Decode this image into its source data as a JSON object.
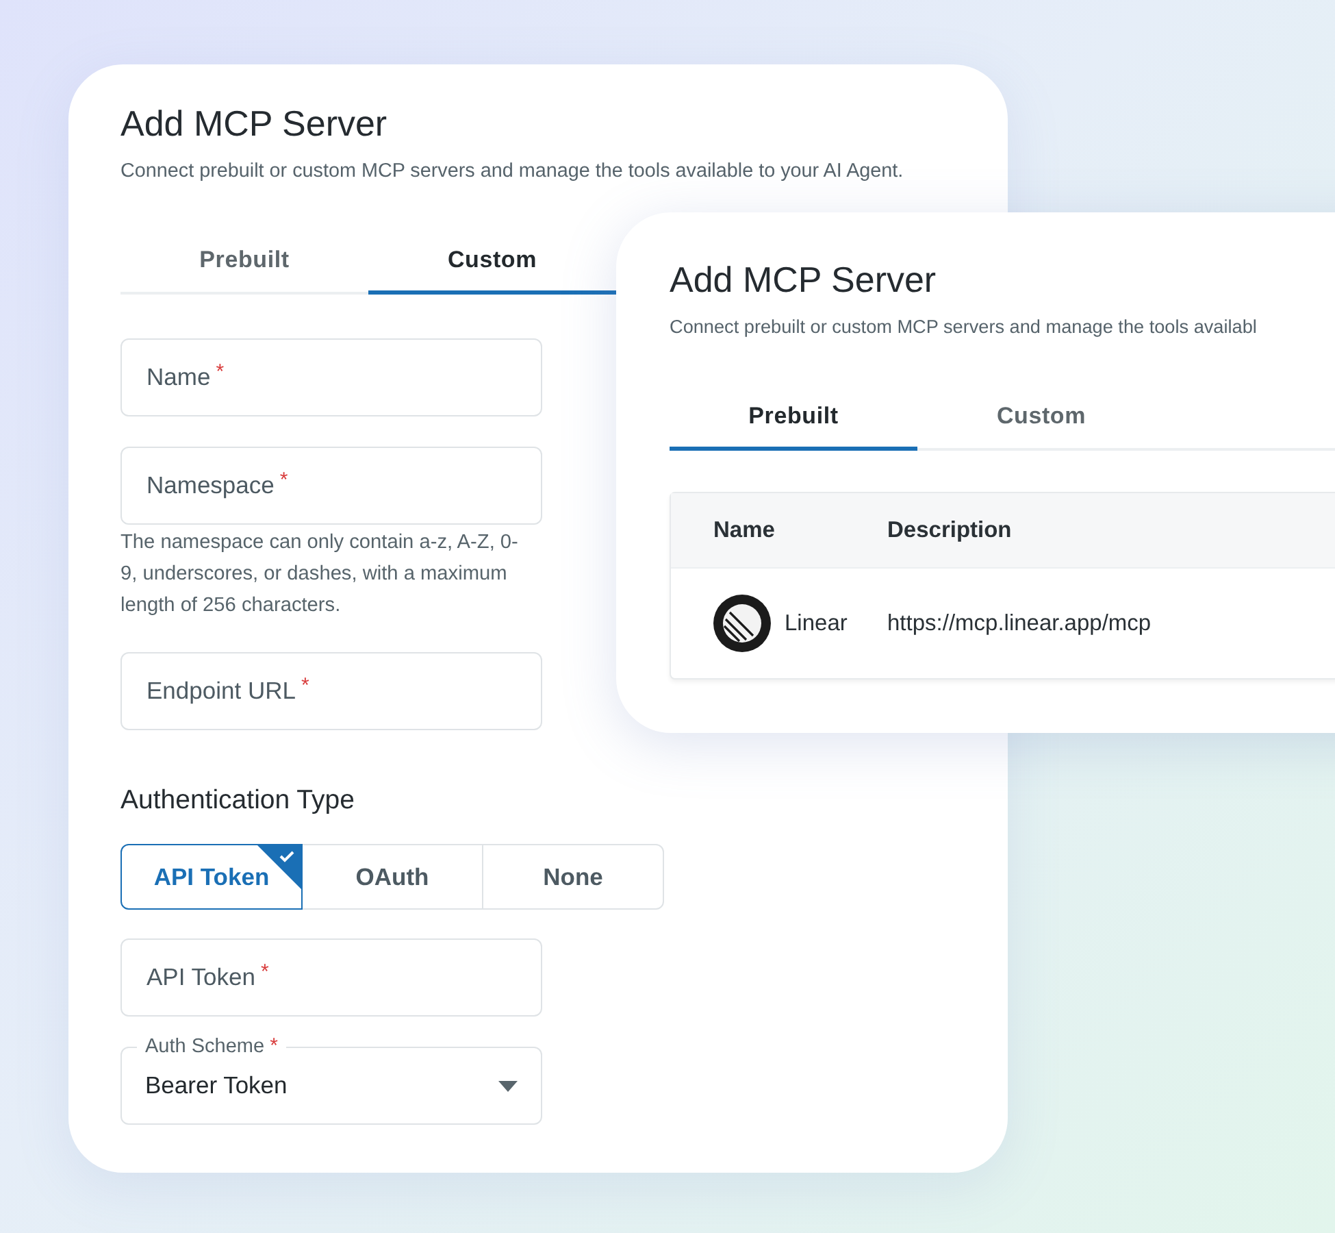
{
  "back_panel": {
    "title": "Add MCP Server",
    "subtitle": "Connect prebuilt or custom MCP servers and manage the tools available to your AI Agent.",
    "tabs": [
      {
        "label": "Prebuilt",
        "selected": false
      },
      {
        "label": "Custom",
        "selected": true
      }
    ],
    "fields": [
      {
        "kind": "input",
        "label": "Name",
        "required_mark": "*"
      },
      {
        "kind": "input",
        "label": "Namespace",
        "required_mark": "*",
        "helper": "The namespace can only contain a-z, A-Z, 0-9, underscores, or dashes, with a maximum length of 256 characters."
      },
      {
        "kind": "input",
        "label": "Endpoint URL",
        "required_mark": "*"
      }
    ],
    "auth_heading": "Authentication Type",
    "auth_options": [
      {
        "label": "API Token",
        "selected": true
      },
      {
        "label": "OAuth",
        "selected": false
      },
      {
        "label": "None",
        "selected": false
      }
    ],
    "auth_fields": [
      {
        "kind": "input",
        "label": "API Token",
        "required_mark": "*"
      },
      {
        "kind": "select",
        "label": "Auth Scheme",
        "required_mark": "*",
        "value": "Bearer Token"
      }
    ]
  },
  "front_panel": {
    "title": "Add MCP Server",
    "subtitle": "Connect prebuilt or custom MCP servers and manage the tools availabl",
    "tabs": [
      {
        "label": "Prebuilt",
        "selected": true
      },
      {
        "label": "Custom",
        "selected": false
      }
    ],
    "table": {
      "columns": [
        "Name",
        "Description"
      ],
      "rows": [
        {
          "name": "Linear",
          "description": "https://mcp.linear.app/mcp"
        }
      ]
    }
  }
}
